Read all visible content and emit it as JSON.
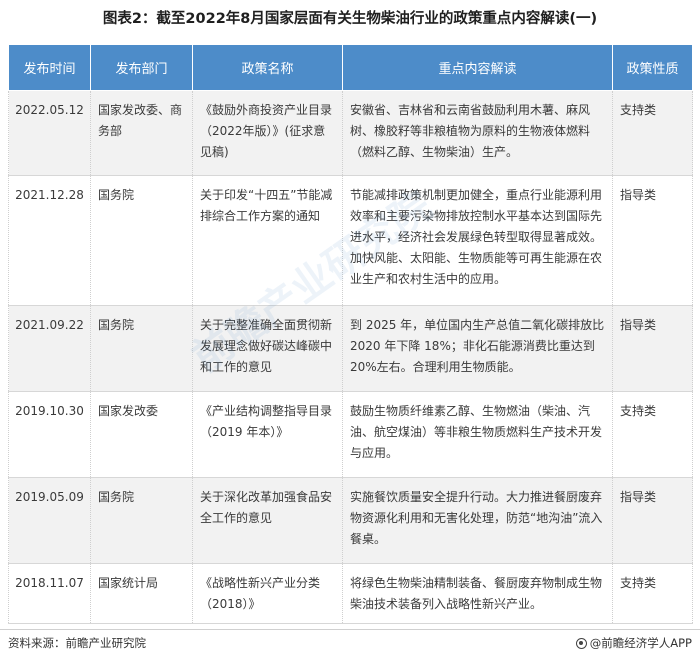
{
  "title": "图表2：截至2022年8月国家层面有关生物柴油行业的政策重点内容解读(一)",
  "table": {
    "headers": [
      "发布时间",
      "发布部门",
      "政策名称",
      "重点内容解读",
      "政策性质"
    ],
    "rows": [
      {
        "date": "2022.05.12",
        "department": "国家发改委、商务部",
        "policy": "《鼓励外商投资产业目录（2022年版）》(征求意见稿)",
        "content": "安徽省、吉林省和云南省鼓励利用木薯、麻风树、橡胶籽等非粮植物为原料的生物液体燃料（燃料乙醇、生物柴油）生产。",
        "nature": "支持类"
      },
      {
        "date": "2021.12.28",
        "department": "国务院",
        "policy": "关于印发“十四五”节能减排综合工作方案的通知",
        "content": "节能减排政策机制更加健全，重点行业能源利用效率和主要污染物排放控制水平基本达到国际先进水平，经济社会发展绿色转型取得显著成效。加快风能、太阳能、生物质能等可再生能源在农业生产和农村生活中的应用。",
        "nature": "指导类"
      },
      {
        "date": "2021.09.22",
        "department": "国务院",
        "policy": "关于完整准确全面贯彻新发展理念做好碳达峰碳中和工作的意见",
        "content": "到 2025 年，单位国内生产总值二氧化碳排放比 2020 年下降 18%；非化石能源消费比重达到 20%左右。合理利用生物质能。",
        "nature": "指导类"
      },
      {
        "date": "2019.10.30",
        "department": "国家发改委",
        "policy": "《产业结构调整指导目录（2019 年本）》",
        "content": "鼓励生物质纤维素乙醇、生物燃油（柴油、汽油、航空煤油）等非粮生物质燃料生产技术开发与应用。",
        "nature": "支持类"
      },
      {
        "date": "2019.05.09",
        "department": "国务院",
        "policy": "关于深化改革加强食品安全工作的意见",
        "content": "实施餐饮质量安全提升行动。大力推进餐厨废弃物资源化利用和无害化处理，防范“地沟油”流入餐桌。",
        "nature": "指导类"
      },
      {
        "date": "2018.11.07",
        "department": "国家统计局",
        "policy": "《战略性新兴产业分类（2018）》",
        "content": "将绿色生物柴油精制装备、餐厨废弃物制成生物柴油技术装备列入战略性新兴产业。",
        "nature": "支持类"
      }
    ]
  },
  "footer": {
    "source": "资料来源：前瞻产业研究院",
    "brand": "@前瞻经济学人APP"
  },
  "watermark": {
    "text": "前瞻产业研究院"
  },
  "colors": {
    "header_bg": "#4d8cc9",
    "stripe_bg": "#f2f2f2"
  }
}
